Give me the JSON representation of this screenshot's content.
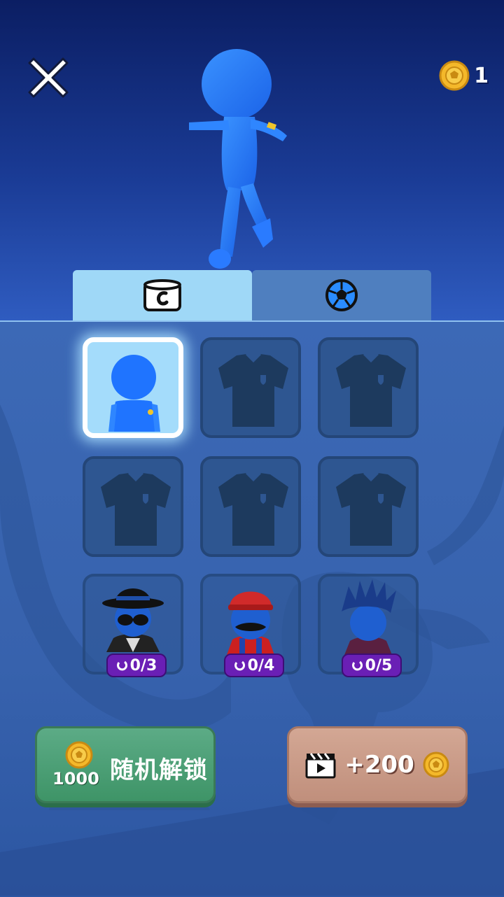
{
  "header": {
    "close_icon": "close-icon",
    "coin_icon": "soccer-coin-icon",
    "coin_count": "1"
  },
  "tabs": [
    {
      "id": "outfit",
      "icon": "shirt-icon",
      "active": true
    },
    {
      "id": "ball",
      "icon": "soccer-ball-icon",
      "active": false
    }
  ],
  "grid": [
    {
      "type": "character",
      "selected": true
    },
    {
      "type": "locked-shirt"
    },
    {
      "type": "locked-shirt"
    },
    {
      "type": "locked-shirt"
    },
    {
      "type": "locked-shirt"
    },
    {
      "type": "locked-shirt"
    },
    {
      "type": "skin-gangster",
      "progress": "0/3"
    },
    {
      "type": "skin-plumber",
      "progress": "0/4"
    },
    {
      "type": "skin-spiky-hair",
      "progress": "0/5"
    }
  ],
  "buttons": {
    "random_unlock_label": "随机解锁",
    "random_unlock_price": "1000",
    "ad_reward": "+200"
  },
  "colors": {
    "accent_green": "#4ea177",
    "ad_button": "#c99a87",
    "badge_purple": "#6a1fb5",
    "hero_blue": "#1f74ff"
  }
}
